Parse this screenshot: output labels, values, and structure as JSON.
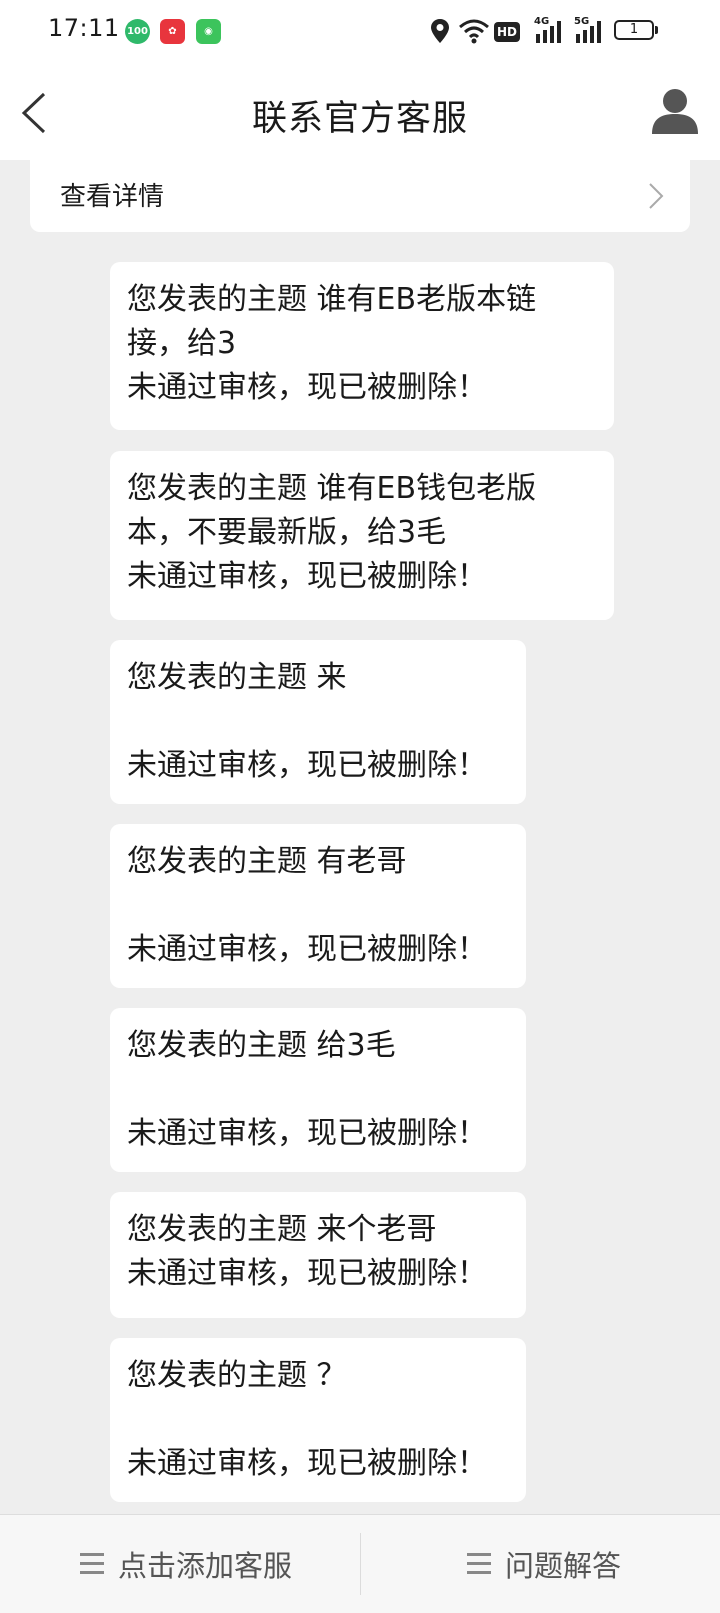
{
  "status_bar": {
    "time": "17:11",
    "battery": "1",
    "network_badge": "HD",
    "signal1": "4G",
    "signal2": "5G"
  },
  "header": {
    "title": "联系官方客服"
  },
  "detail": {
    "label": "查看详情"
  },
  "messages": [
    {
      "lines": [
        "您发表的主题 谁有EB老版本链",
        "接，给3",
        "未通过审核，现已被删除！"
      ]
    },
    {
      "lines": [
        "您发表的主题 谁有EB钱包老版",
        "本，不要最新版，给3毛",
        "未通过审核，现已被删除！"
      ]
    },
    {
      "lines": [
        "您发表的主题 来",
        "",
        "未通过审核，现已被删除！"
      ]
    },
    {
      "lines": [
        "您发表的主题 有老哥",
        "",
        "未通过审核，现已被删除！"
      ]
    },
    {
      "lines": [
        "您发表的主题 给3毛",
        "",
        "未通过审核，现已被删除！"
      ]
    },
    {
      "lines": [
        "您发表的主题 来个老哥",
        "未通过审核，现已被删除！"
      ]
    },
    {
      "lines": [
        "您发表的主题 ？",
        "",
        "未通过审核，现已被删除！"
      ]
    }
  ],
  "bottom_nav": {
    "add_service_label": "点击添加客服",
    "faq_label": "问题解答"
  },
  "colors": {
    "background": "#eeeeee",
    "bubble": "#ffffff",
    "bottom_bar": "#f7f7f7"
  }
}
